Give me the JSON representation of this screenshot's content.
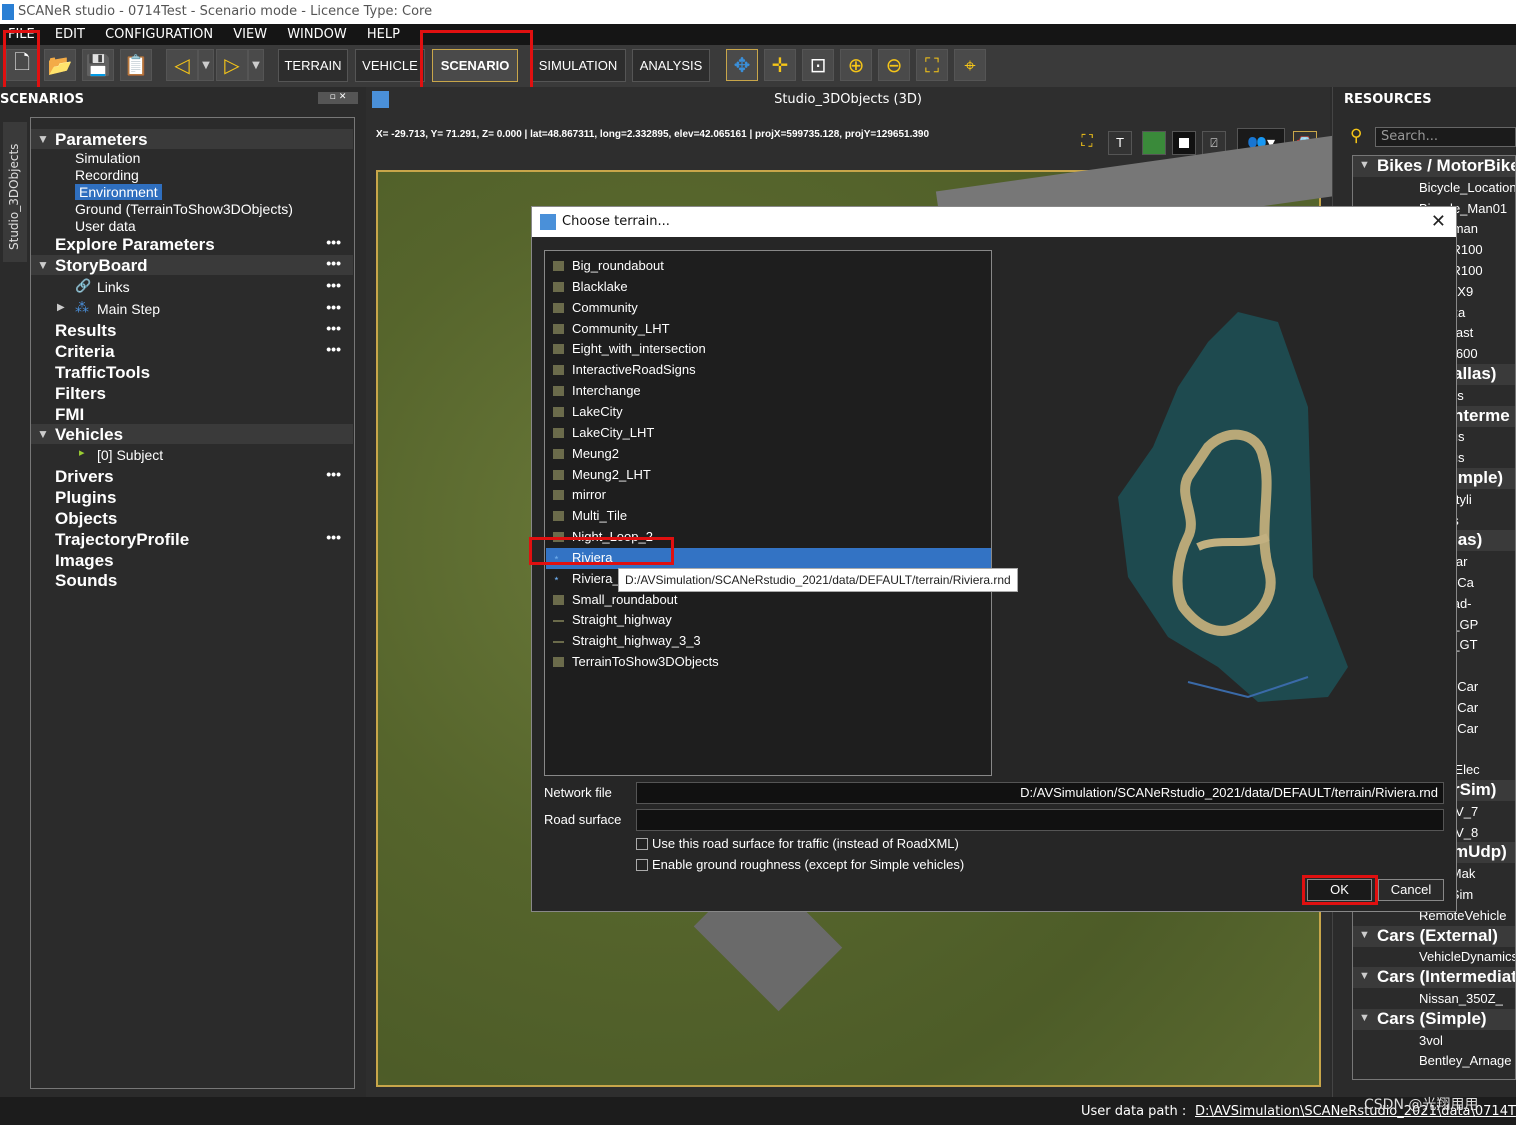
{
  "window": {
    "title": "SCANeR studio - 0714Test - Scenario mode - Licence Type: Core"
  },
  "menu": [
    "FILE",
    "EDIT",
    "CONFIGURATION",
    "VIEW",
    "WINDOW",
    "HELP"
  ],
  "toolbar": {
    "modes": [
      "TERRAIN",
      "VEHICLE",
      "SCENARIO",
      "SIMULATION",
      "ANALYSIS"
    ]
  },
  "scenarios": {
    "header": "SCENARIOS",
    "vertical_tab": "Studio_3DObjects",
    "tree": [
      {
        "label": "Parameters",
        "kind": "section",
        "dots": ""
      },
      {
        "label": "Simulation",
        "kind": "sub"
      },
      {
        "label": "Recording",
        "kind": "sub"
      },
      {
        "label": "Environment",
        "kind": "sub-selected"
      },
      {
        "label": "Ground (TerrainToShow3DObjects)",
        "kind": "sub"
      },
      {
        "label": "User data",
        "kind": "sub"
      },
      {
        "label": "Explore Parameters",
        "kind": "item",
        "dots": "•••"
      },
      {
        "label": "StoryBoard",
        "kind": "section",
        "dots": "•••"
      },
      {
        "label": "Links",
        "kind": "sub-link",
        "dots": "•••"
      },
      {
        "label": "Main Step",
        "kind": "sub-step",
        "dots": "•••"
      },
      {
        "label": "Results",
        "kind": "item",
        "dots": "•••"
      },
      {
        "label": "Criteria",
        "kind": "item",
        "dots": "•••"
      },
      {
        "label": "TrafficTools",
        "kind": "item",
        "dots": ""
      },
      {
        "label": "Filters",
        "kind": "item",
        "dots": ""
      },
      {
        "label": "FMI",
        "kind": "item",
        "dots": ""
      },
      {
        "label": "Vehicles",
        "kind": "section",
        "dots": ""
      },
      {
        "label": "[0] Subject",
        "kind": "sub-veh"
      },
      {
        "label": "Drivers",
        "kind": "item",
        "dots": "•••"
      },
      {
        "label": "Plugins",
        "kind": "item",
        "dots": ""
      },
      {
        "label": "Objects",
        "kind": "item",
        "dots": ""
      },
      {
        "label": "TrajectoryProfile",
        "kind": "item",
        "dots": "•••"
      },
      {
        "label": "Images",
        "kind": "item",
        "dots": ""
      },
      {
        "label": "Sounds",
        "kind": "item",
        "dots": ""
      }
    ]
  },
  "viewport": {
    "title": "Studio_3DObjects (3D)",
    "coords": "X= -29.713, Y=  71.291, Z=   0.000 | lat=48.867311, long=2.332895, elev=42.065161 | projX=599735.128, projY=129651.390"
  },
  "resources": {
    "header": "RESOURCES",
    "search_placeholder": "Search...",
    "items": [
      {
        "label": "Bikes / MotorBikes",
        "kind": "cat"
      },
      {
        "label": "Bicycle_Location",
        "kind": "leaf"
      },
      {
        "label": "Bicycle_Man01",
        "kind": "leaf"
      },
      {
        "label": "e_Woman",
        "kind": "leaf"
      },
      {
        "label": "a_CBR100",
        "kind": "leaf"
      },
      {
        "label": "a_CBR100",
        "kind": "leaf"
      },
      {
        "label": "saki_ZX9",
        "kind": "leaf"
      },
      {
        "label": "d_Pizza",
        "kind": "leaf"
      },
      {
        "label": "eot_Blast",
        "kind": "leaf"
      },
      {
        "label": "ha_XJ600",
        "kind": "leaf"
      },
      {
        "label": "allas)",
        "kind": "cat"
      },
      {
        "label": "CityBus",
        "kind": "leaf"
      },
      {
        "label": "nterme",
        "kind": "cat"
      },
      {
        "label": "_Irisbus",
        "kind": "leaf"
      },
      {
        "label": "_Irisbus",
        "kind": "leaf"
      },
      {
        "label": "imple)",
        "kind": "cat"
      },
      {
        "label": "lan_Cityli",
        "kind": "leaf"
      },
      {
        "label": "ol_Bus",
        "kind": "leaf"
      },
      {
        "label": "las)",
        "kind": "cat"
      },
      {
        "label": "ativeCar",
        "kind": "leaf"
      },
      {
        "label": "FamilyCa",
        "kind": "leaf"
      },
      {
        "label": "OffRoad-",
        "kind": "leaf"
      },
      {
        "label": "rsport_GP",
        "kind": "leaf"
      },
      {
        "label": "rsport_GT",
        "kind": "leaf"
      },
      {
        "label": "p",
        "kind": "leaf"
      },
      {
        "label": "FamilyCar",
        "kind": "leaf"
      },
      {
        "label": "FamilyCar",
        "kind": "leaf"
      },
      {
        "label": "FamilyCar",
        "kind": "leaf"
      },
      {
        "label": "rMini",
        "kind": "leaf"
      },
      {
        "label": "rMini_Elec",
        "kind": "leaf"
      },
      {
        "label": "rSim)",
        "kind": "cat"
      },
      {
        "label": "m_SUV_7",
        "kind": "leaf"
      },
      {
        "label": "m_SUV_8",
        "kind": "leaf"
      },
      {
        "label": "mUdp)",
        "kind": "cat"
      },
      {
        "label": "teCarMak",
        "kind": "leaf"
      },
      {
        "label": "teCarSim",
        "kind": "leaf"
      },
      {
        "label": "RemoteVehicle",
        "kind": "leaf"
      },
      {
        "label": "Cars (External)",
        "kind": "cat"
      },
      {
        "label": "VehicleDynamics",
        "kind": "leaf"
      },
      {
        "label": "Cars (Intermediate)",
        "kind": "cat"
      },
      {
        "label": "Nissan_350Z_",
        "kind": "leaf"
      },
      {
        "label": "Cars (Simple)",
        "kind": "cat"
      },
      {
        "label": "3vol",
        "kind": "leaf"
      },
      {
        "label": "Bentley_Arnage",
        "kind": "leaf"
      }
    ]
  },
  "dialog": {
    "title": "Choose terrain...",
    "terrains": [
      "Big_roundabout",
      "Blacklake",
      "Community",
      "Community_LHT",
      "Eight_with_intersection",
      "InteractiveRoadSigns",
      "Interchange",
      "LakeCity",
      "LakeCity_LHT",
      "Meung2",
      "Meung2_LHT",
      "mirror",
      "Multi_Tile",
      "Night_Loop_2",
      "Riviera",
      "Riviera_",
      "Small_roundabout",
      "Straight_highway",
      "Straight_highway_3_3",
      "TerrainToShow3DObjects"
    ],
    "selected_index": 14,
    "tooltip": "D:/AVSimulation/SCANeRstudio_2021/data/DEFAULT/terrain/Riviera.rnd",
    "network_file_label": "Network file",
    "network_file_value": "D:/AVSimulation/SCANeRstudio_2021/data/DEFAULT/terrain/Riviera.rnd",
    "road_surface_label": "Road surface",
    "road_surface_value": "",
    "check_traffic": "Use this road surface for traffic (instead of RoadXML)",
    "check_roughness": "Enable ground roughness (except for Simple vehicles)",
    "ok": "OK",
    "cancel": "Cancel"
  },
  "status": {
    "label": "User data path :",
    "path": "D:\\AVSimulation\\SCANeRstudio_2021\\data\\0714T"
  },
  "watermark": "CSDN @光翔用用"
}
